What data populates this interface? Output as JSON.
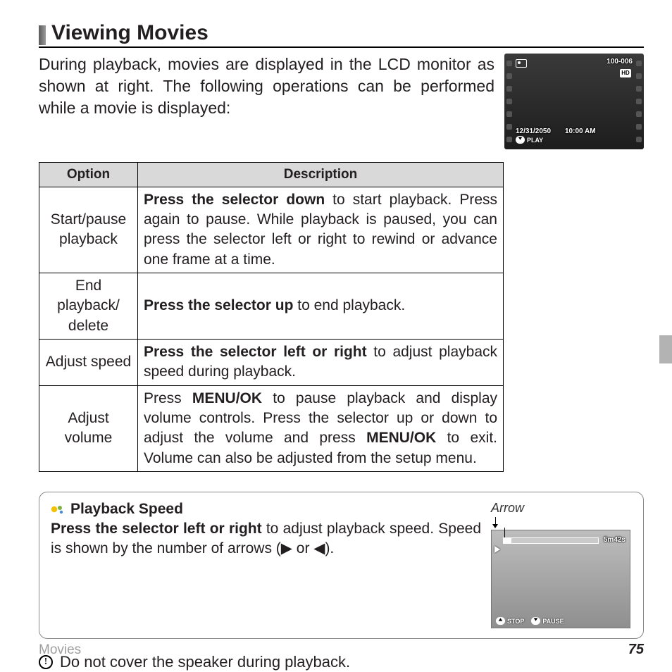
{
  "heading": "Viewing Movies",
  "intro": "During playback, movies are displayed in the LCD monitor as shown at right. The following operations can be performed while a movie is displayed:",
  "lcd1": {
    "file_no": "100-006",
    "hd": "HD",
    "date": "12/31/2050",
    "time": "10:00 AM",
    "play": "PLAY"
  },
  "table": {
    "headers": [
      "Option",
      "Description"
    ],
    "rows": [
      {
        "option": "Start/pause playback",
        "desc_bold": "Press the selector down",
        "desc_rest": " to start playback. Press again to pause. While playback is paused, you can press the selector left or right to rewind or advance one frame at a time."
      },
      {
        "option": "End playback/\ndelete",
        "desc_bold": "Press the selector up",
        "desc_rest": " to end playback."
      },
      {
        "option": "Adjust speed",
        "desc_bold": "Press the selector left or right",
        "desc_rest": " to adjust playback speed during playback."
      },
      {
        "option": "Adjust volume",
        "desc_pre_bold": "Press ",
        "desc_bold": "MENU/OK",
        "desc_mid": " to pause playback and display volume controls. Press the selector up or down to adjust the volume and press ",
        "desc_bold2": "MENU/OK",
        "desc_rest": " to exit. Volume can also be adjusted from the setup menu."
      }
    ]
  },
  "note": {
    "title": "Playback Speed",
    "body_bold": "Press the selector left or right",
    "body_rest": " to adjust playback speed. Speed is shown by the number of arrows (▶ or ◀).",
    "arrow_label": "Arrow",
    "lcd2": {
      "duration": "5m42s",
      "stop": "STOP",
      "pause": "PAUSE"
    }
  },
  "warning": "Do not cover the speaker during playback.",
  "footer": {
    "section": "Movies",
    "page": "75"
  }
}
